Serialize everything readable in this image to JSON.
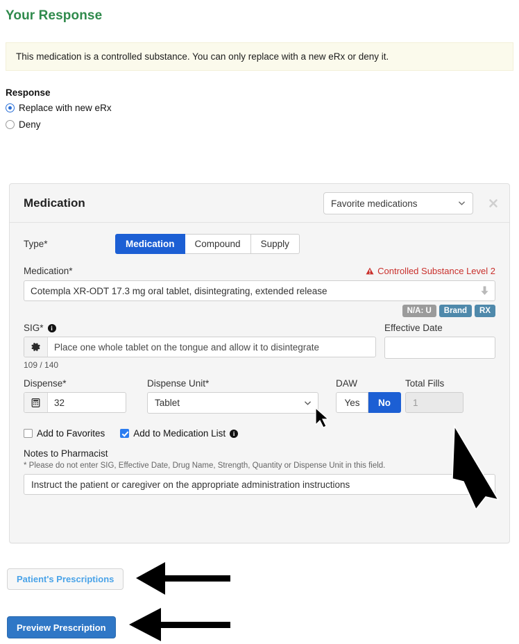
{
  "page": {
    "title": "Your Response",
    "title_color": "#2f8a4c",
    "alert_text": "This medication is a controlled substance. You can only replace with a new eRx or deny it.",
    "alert_bg": "#fbfaec"
  },
  "response": {
    "label": "Response",
    "options": [
      {
        "label": "Replace with new eRx",
        "selected": true
      },
      {
        "label": "Deny",
        "selected": false
      }
    ]
  },
  "medication_panel": {
    "title": "Medication",
    "favorites_select": {
      "value": "Favorite medications"
    },
    "close_icon": "close-icon",
    "type": {
      "label": "Type*",
      "options": [
        {
          "label": "Medication",
          "active": true
        },
        {
          "label": "Compound",
          "active": false
        },
        {
          "label": "Supply",
          "active": false
        }
      ]
    },
    "medication": {
      "label": "Medication*",
      "warning": "Controlled Substance Level 2",
      "warning_color": "#c9302c",
      "value": "Cotempla XR-ODT 17.3 mg oral tablet, disintegrating, extended release",
      "dropdown_icon": "down-arrow-icon",
      "badges": [
        {
          "label": "N/A: U",
          "color": "#9b9b9b"
        },
        {
          "label": "Brand",
          "color": "#4f89ab"
        },
        {
          "label": "RX",
          "color": "#4f89ab"
        }
      ]
    },
    "sig": {
      "label": "SIG*",
      "info_icon": "info-icon",
      "gear_icon": "gear-icon",
      "value": "Place one whole tablet on the tongue and allow it to disintegrate",
      "counter": "109 / 140"
    },
    "effective_date": {
      "label": "Effective Date",
      "value": ""
    },
    "dispense": {
      "label": "Dispense*",
      "calculator_icon": "calculator-icon",
      "value": "32"
    },
    "dispense_unit": {
      "label": "Dispense Unit*",
      "value": "Tablet"
    },
    "daw": {
      "label": "DAW",
      "options": [
        {
          "label": "Yes",
          "active": false
        },
        {
          "label": "No",
          "active": true
        }
      ]
    },
    "total_fills": {
      "label": "Total Fills",
      "value": "1",
      "disabled": true
    },
    "checkboxes": [
      {
        "label": "Add to Favorites",
        "checked": false,
        "info": false
      },
      {
        "label": "Add to Medication List",
        "checked": true,
        "info": true
      }
    ],
    "notes": {
      "label": "Notes to Pharmacist",
      "hint": "* Please do not enter SIG, Effective Date, Drug Name, Strength, Quantity or Dispense Unit in this field.",
      "value": "Instruct the patient or caregiver on the appropriate administration instructions"
    }
  },
  "footer": {
    "patients_prescriptions": "Patient's Prescriptions",
    "preview_prescription": "Preview Prescription"
  }
}
